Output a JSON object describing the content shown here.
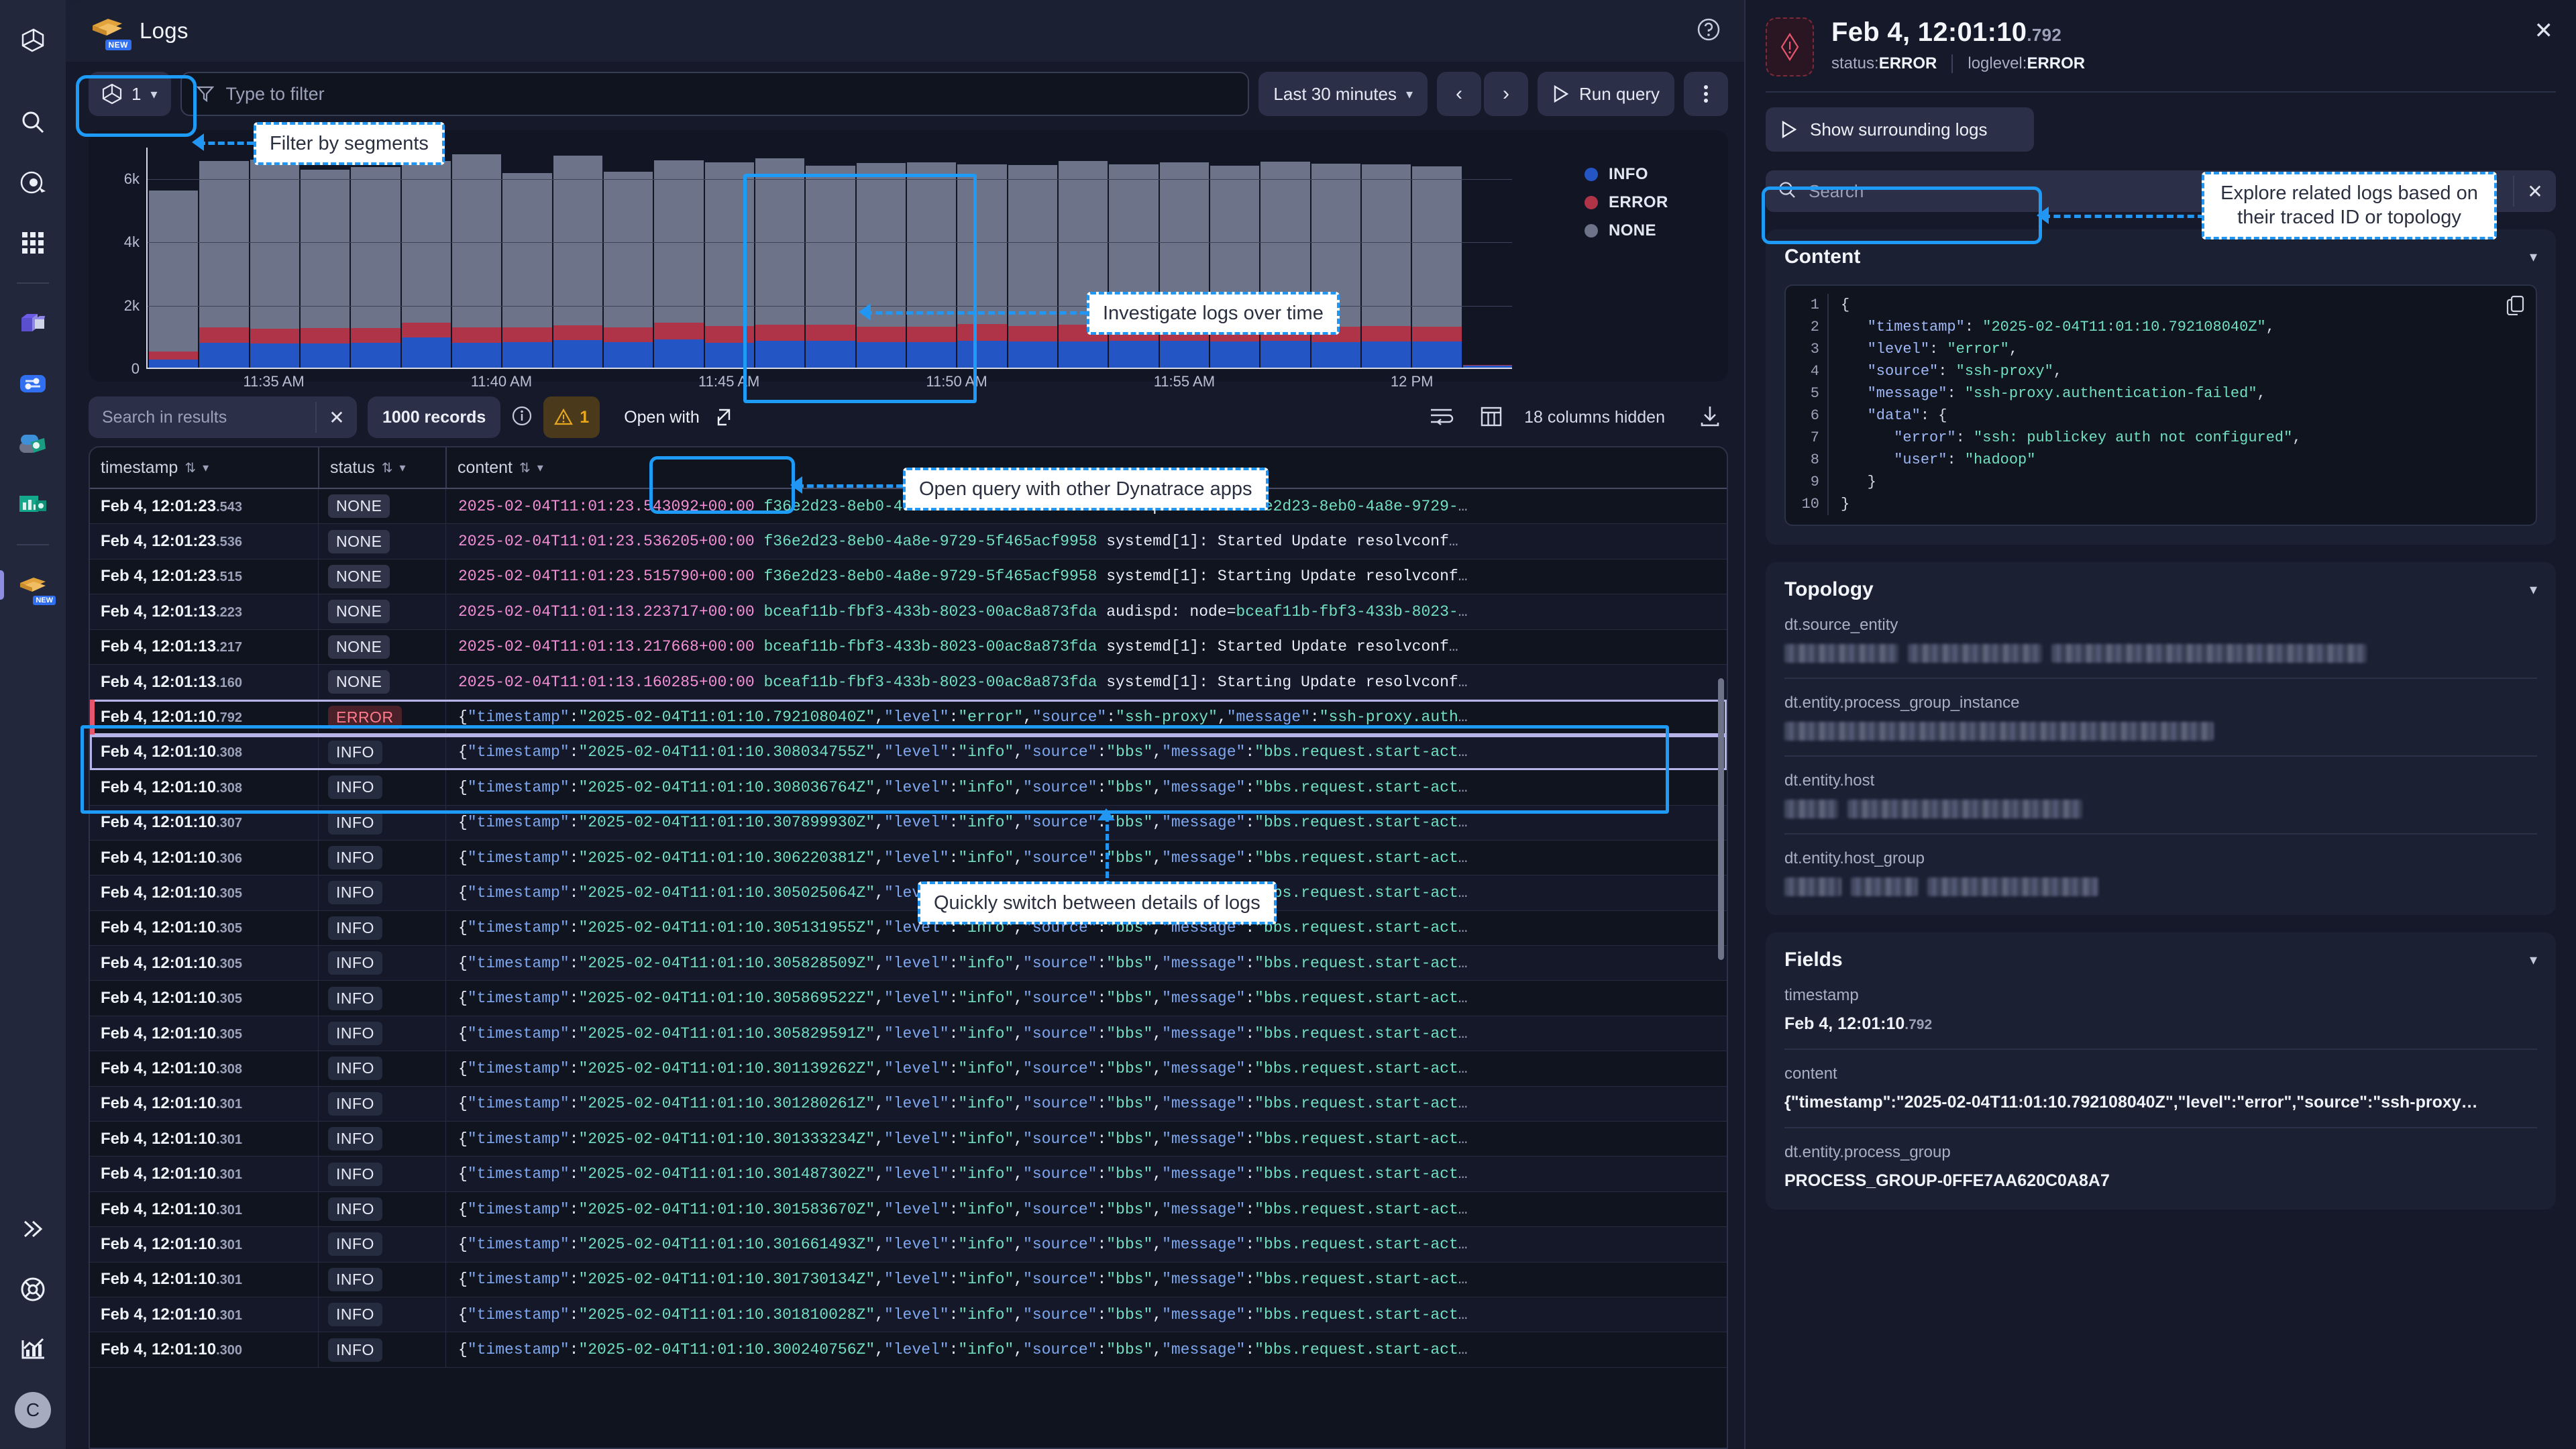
{
  "rail": {
    "items": [
      {
        "name": "dynatrace-logo-icon",
        "label": "Dynatrace"
      },
      {
        "name": "search-icon",
        "label": "Search"
      },
      {
        "name": "davis-ai-icon",
        "label": "Davis AI"
      },
      {
        "name": "apps-grid-icon",
        "label": "Apps"
      },
      {
        "name": "kubernetes-app-icon",
        "label": "Kubernetes"
      },
      {
        "name": "distributed-tracing-app-icon",
        "label": "Distributed Tracing"
      },
      {
        "name": "databases-app-icon",
        "label": "Databases"
      },
      {
        "name": "dashboards-app-icon",
        "label": "Dashboards"
      },
      {
        "name": "logs-app-icon",
        "label": "Logs",
        "badge": "NEW",
        "active": true
      },
      {
        "name": "expand-rail-icon",
        "label": "Expand"
      },
      {
        "name": "support-icon",
        "label": "Support"
      },
      {
        "name": "analytics-icon",
        "label": "Analytics"
      }
    ],
    "avatar_initial": "C"
  },
  "titlebar": {
    "app_name": "Logs",
    "badge": "NEW",
    "help_icon": "help-circle-icon"
  },
  "toolbar": {
    "segment_count": "1",
    "filter_placeholder": "Type to filter",
    "timeframe": "Last 30 minutes",
    "prev_label": "‹",
    "next_label": "›",
    "run_query_label": "Run query",
    "more_label": "⋮"
  },
  "chart_data": {
    "type": "bar",
    "title": "",
    "xlabel": "",
    "ylabel": "",
    "stacked": true,
    "grid": true,
    "legend_position": "right",
    "ylim": [
      0,
      7000
    ],
    "yticks": [
      0,
      2000,
      4000,
      6000
    ],
    "ytick_labels": [
      "0",
      "2k",
      "4k",
      "6k"
    ],
    "xtick_labels": [
      "11:35 AM",
      "11:40 AM",
      "11:45 AM",
      "11:50 AM",
      "11:55 AM",
      "12 PM"
    ],
    "legend": [
      {
        "name": "INFO",
        "color": "#2455c4"
      },
      {
        "name": "ERROR",
        "color": "#b03448"
      },
      {
        "name": "NONE",
        "color": "#6d7389"
      }
    ],
    "series": [
      {
        "name": "INFO",
        "color": "#2455c4",
        "values": [
          260,
          780,
          760,
          760,
          790,
          960,
          790,
          810,
          870,
          800,
          900,
          790,
          840,
          840,
          800,
          810,
          850,
          830,
          830,
          850,
          840,
          820,
          840,
          800,
          830,
          820,
          60
        ]
      },
      {
        "name": "ERROR",
        "color": "#b03448",
        "values": [
          250,
          500,
          480,
          500,
          470,
          470,
          490,
          460,
          470,
          470,
          520,
          520,
          520,
          510,
          500,
          490,
          520,
          490,
          520,
          490,
          510,
          480,
          490,
          500,
          480,
          470,
          30
        ]
      },
      {
        "name": "NONE",
        "color": "#6d7389",
        "values": [
          5080,
          5260,
          5330,
          5000,
          5080,
          5110,
          5460,
          4880,
          5370,
          4920,
          5140,
          5190,
          5250,
          5040,
          5160,
          5200,
          5060,
          5080,
          5190,
          5080,
          5140,
          5080,
          5180,
          5140,
          5120,
          5080,
          0
        ]
      }
    ]
  },
  "results": {
    "search_placeholder": "Search in results",
    "record_count": "1000 records",
    "info_icon": "info-circle-icon",
    "warning_count": "1",
    "open_with_label": "Open with",
    "wrap_lines_icon": "wrap-lines-icon",
    "columns_icon": "table-columns-icon",
    "columns_hidden": "18 columns hidden",
    "download_icon": "download-icon"
  },
  "table": {
    "columns": [
      {
        "key": "timestamp",
        "label": "timestamp"
      },
      {
        "key": "status",
        "label": "status"
      },
      {
        "key": "content",
        "label": "content"
      }
    ],
    "rows": [
      {
        "ts": "Feb 4, 12:01:23",
        "ms": ".543",
        "status": "NONE",
        "kind": "syslog",
        "iso": "2025-02-04T11:01:23.543092+00:00",
        "uuid": "f36e2d23-8eb0-4a8e-9729-5f465acf9958",
        "msg": "audispd: node=f36e2d23-8eb0-4a8e-9729-",
        "msg_teal_tail": true
      },
      {
        "ts": "Feb 4, 12:01:23",
        "ms": ".536",
        "status": "NONE",
        "kind": "syslog",
        "iso": "2025-02-04T11:01:23.536205+00:00",
        "uuid": "f36e2d23-8eb0-4a8e-9729-5f465acf9958",
        "msg": "systemd[1]: Started Update resolvconf "
      },
      {
        "ts": "Feb 4, 12:01:23",
        "ms": ".515",
        "status": "NONE",
        "kind": "syslog",
        "iso": "2025-02-04T11:01:23.515790+00:00",
        "uuid": "f36e2d23-8eb0-4a8e-9729-5f465acf9958",
        "msg": "systemd[1]: Starting Update resolvconf"
      },
      {
        "ts": "Feb 4, 12:01:13",
        "ms": ".223",
        "status": "NONE",
        "kind": "syslog",
        "iso": "2025-02-04T11:01:13.223717+00:00",
        "uuid": "bceaf11b-fbf3-433b-8023-00ac8a873fda",
        "msg": "audispd: node=bceaf11b-fbf3-433b-8023-",
        "msg_teal_tail": true
      },
      {
        "ts": "Feb 4, 12:01:13",
        "ms": ".217",
        "status": "NONE",
        "kind": "syslog",
        "iso": "2025-02-04T11:01:13.217668+00:00",
        "uuid": "bceaf11b-fbf3-433b-8023-00ac8a873fda",
        "msg": "systemd[1]: Started Update resolvconf "
      },
      {
        "ts": "Feb 4, 12:01:13",
        "ms": ".160",
        "status": "NONE",
        "kind": "syslog",
        "selected_top": true,
        "iso": "2025-02-04T11:01:13.160285+00:00",
        "uuid": "bceaf11b-fbf3-433b-8023-00ac8a873fda",
        "msg": "systemd[1]: Starting Update resolvconf"
      },
      {
        "ts": "Feb 4, 12:01:10",
        "ms": ".792",
        "status": "ERROR",
        "kind": "json",
        "active": true,
        "json_ts": "2025-02-04T11:01:10.792108040Z",
        "level": "error",
        "source": "ssh-proxy",
        "msg_key": "message",
        "msg_val": "ssh-proxy.auth"
      },
      {
        "ts": "Feb 4, 12:01:10",
        "ms": ".308",
        "status": "INFO",
        "kind": "json",
        "selected_bottom": true,
        "json_ts": "2025-02-04T11:01:10.308034755Z",
        "level": "info",
        "source": "bbs",
        "msg_key": "message",
        "msg_val": "bbs.request.start-act"
      },
      {
        "ts": "Feb 4, 12:01:10",
        "ms": ".308",
        "status": "INFO",
        "kind": "json",
        "json_ts": "2025-02-04T11:01:10.308036764Z",
        "level": "info",
        "source": "bbs",
        "msg_key": "message",
        "msg_val": "bbs.request.start-act"
      },
      {
        "ts": "Feb 4, 12:01:10",
        "ms": ".307",
        "status": "INFO",
        "kind": "json",
        "json_ts": "2025-02-04T11:01:10.307899930Z",
        "level": "info",
        "source": "bbs",
        "msg_key": "message",
        "msg_val": "bbs.request.start-act"
      },
      {
        "ts": "Feb 4, 12:01:10",
        "ms": ".306",
        "status": "INFO",
        "kind": "json",
        "json_ts": "2025-02-04T11:01:10.306220381Z",
        "level": "info",
        "source": "bbs",
        "msg_key": "message",
        "msg_val": "bbs.request.start-act"
      },
      {
        "ts": "Feb 4, 12:01:10",
        "ms": ".305",
        "status": "INFO",
        "kind": "json",
        "json_ts": "2025-02-04T11:01:10.305025064Z",
        "level": "info",
        "source": "bbs",
        "msg_key": "message",
        "msg_val": "bbs.request.start-act"
      },
      {
        "ts": "Feb 4, 12:01:10",
        "ms": ".305",
        "status": "INFO",
        "kind": "json",
        "json_ts": "2025-02-04T11:01:10.305131955Z",
        "level": "info",
        "source": "bbs",
        "msg_key": "message",
        "msg_val": "bbs.request.start-act"
      },
      {
        "ts": "Feb 4, 12:01:10",
        "ms": ".305",
        "status": "INFO",
        "kind": "json",
        "json_ts": "2025-02-04T11:01:10.305828509Z",
        "level": "info",
        "source": "bbs",
        "msg_key": "message",
        "msg_val": "bbs.request.start-act"
      },
      {
        "ts": "Feb 4, 12:01:10",
        "ms": ".305",
        "status": "INFO",
        "kind": "json",
        "json_ts": "2025-02-04T11:01:10.305869522Z",
        "level": "info",
        "source": "bbs",
        "msg_key": "message",
        "msg_val": "bbs.request.start-act"
      },
      {
        "ts": "Feb 4, 12:01:10",
        "ms": ".305",
        "status": "INFO",
        "kind": "json",
        "json_ts": "2025-02-04T11:01:10.305829591Z",
        "level": "info",
        "source": "bbs",
        "msg_key": "message",
        "msg_val": "bbs.request.start-act"
      },
      {
        "ts": "Feb 4, 12:01:10",
        "ms": ".308",
        "status": "INFO",
        "kind": "json",
        "json_ts": "2025-02-04T11:01:10.301139262Z",
        "level": "info",
        "source": "bbs",
        "msg_key": "message",
        "msg_val": "bbs.request.start-act"
      },
      {
        "ts": "Feb 4, 12:01:10",
        "ms": ".301",
        "status": "INFO",
        "kind": "json",
        "json_ts": "2025-02-04T11:01:10.301280261Z",
        "level": "info",
        "source": "bbs",
        "msg_key": "message",
        "msg_val": "bbs.request.start-act"
      },
      {
        "ts": "Feb 4, 12:01:10",
        "ms": ".301",
        "status": "INFO",
        "kind": "json",
        "json_ts": "2025-02-04T11:01:10.301333234Z",
        "level": "info",
        "source": "bbs",
        "msg_key": "message",
        "msg_val": "bbs.request.start-act"
      },
      {
        "ts": "Feb 4, 12:01:10",
        "ms": ".301",
        "status": "INFO",
        "kind": "json",
        "json_ts": "2025-02-04T11:01:10.301487302Z",
        "level": "info",
        "source": "bbs",
        "msg_key": "message",
        "msg_val": "bbs.request.start-act"
      },
      {
        "ts": "Feb 4, 12:01:10",
        "ms": ".301",
        "status": "INFO",
        "kind": "json",
        "json_ts": "2025-02-04T11:01:10.301583670Z",
        "level": "info",
        "source": "bbs",
        "msg_key": "message",
        "msg_val": "bbs.request.start-act"
      },
      {
        "ts": "Feb 4, 12:01:10",
        "ms": ".301",
        "status": "INFO",
        "kind": "json",
        "json_ts": "2025-02-04T11:01:10.301661493Z",
        "level": "info",
        "source": "bbs",
        "msg_key": "message",
        "msg_val": "bbs.request.start-act"
      },
      {
        "ts": "Feb 4, 12:01:10",
        "ms": ".301",
        "status": "INFO",
        "kind": "json",
        "json_ts": "2025-02-04T11:01:10.301730134Z",
        "level": "info",
        "source": "bbs",
        "msg_key": "message",
        "msg_val": "bbs.request.start-act"
      },
      {
        "ts": "Feb 4, 12:01:10",
        "ms": ".301",
        "status": "INFO",
        "kind": "json",
        "json_ts": "2025-02-04T11:01:10.301810028Z",
        "level": "info",
        "source": "bbs",
        "msg_key": "message",
        "msg_val": "bbs.request.start-act"
      },
      {
        "ts": "Feb 4, 12:01:10",
        "ms": ".300",
        "status": "INFO",
        "kind": "json",
        "json_ts": "2025-02-04T11:01:10.300240756Z",
        "level": "info",
        "source": "bbs",
        "msg_key": "message",
        "msg_val": "bbs.request.start-act"
      }
    ]
  },
  "detail": {
    "title": "Feb 4, 12:01:10",
    "title_ms": ".792",
    "status_key": "status",
    "status_value": "ERROR",
    "loglevel_key": "loglevel",
    "loglevel_value": "ERROR",
    "close_label": "✕",
    "surrounding_logs_label": "Show surrounding logs",
    "search_placeholder": "Search",
    "content_section": {
      "title": "Content",
      "copy_icon": "copy-icon",
      "lines": [
        {
          "n": "1",
          "parts": [
            {
              "t": "{",
              "c": "cp"
            }
          ]
        },
        {
          "n": "2",
          "indent": 1,
          "parts": [
            {
              "t": "\"timestamp\"",
              "c": "ck"
            },
            {
              "t": ": ",
              "c": "cp"
            },
            {
              "t": "\"2025-02-04T11:01:10.792108040Z\"",
              "c": "cv"
            },
            {
              "t": ",",
              "c": "cp"
            }
          ]
        },
        {
          "n": "3",
          "indent": 1,
          "parts": [
            {
              "t": "\"level\"",
              "c": "ck"
            },
            {
              "t": ": ",
              "c": "cp"
            },
            {
              "t": "\"error\"",
              "c": "cv"
            },
            {
              "t": ",",
              "c": "cp"
            }
          ]
        },
        {
          "n": "4",
          "indent": 1,
          "parts": [
            {
              "t": "\"source\"",
              "c": "ck"
            },
            {
              "t": ": ",
              "c": "cp"
            },
            {
              "t": "\"ssh-proxy\"",
              "c": "cv"
            },
            {
              "t": ",",
              "c": "cp"
            }
          ]
        },
        {
          "n": "5",
          "indent": 1,
          "parts": [
            {
              "t": "\"message\"",
              "c": "ck"
            },
            {
              "t": ": ",
              "c": "cp"
            },
            {
              "t": "\"ssh-proxy.authentication-failed\"",
              "c": "cv"
            },
            {
              "t": ",",
              "c": "cp"
            }
          ]
        },
        {
          "n": "6",
          "indent": 1,
          "parts": [
            {
              "t": "\"data\"",
              "c": "ck"
            },
            {
              "t": ": {",
              "c": "cp"
            }
          ]
        },
        {
          "n": "7",
          "indent": 2,
          "parts": [
            {
              "t": "\"error\"",
              "c": "ck"
            },
            {
              "t": ": ",
              "c": "cp"
            },
            {
              "t": "\"ssh: publickey auth not configured\"",
              "c": "cv"
            },
            {
              "t": ",",
              "c": "cp"
            }
          ]
        },
        {
          "n": "8",
          "indent": 2,
          "parts": [
            {
              "t": "\"user\"",
              "c": "ck"
            },
            {
              "t": ": ",
              "c": "cp"
            },
            {
              "t": "\"hadoop\"",
              "c": "cv"
            }
          ]
        },
        {
          "n": "9",
          "indent": 1,
          "parts": [
            {
              "t": "}",
              "c": "cp"
            }
          ]
        },
        {
          "n": "10",
          "parts": [
            {
              "t": "}",
              "c": "cp"
            }
          ]
        }
      ]
    },
    "topology_section": {
      "title": "Topology",
      "rows": [
        {
          "key": "dt.source_entity",
          "redacted": true,
          "widths": [
            170,
            200,
            470
          ]
        },
        {
          "key": "dt.entity.process_group_instance",
          "redacted": true,
          "widths": [
            640
          ]
        },
        {
          "key": "dt.entity.host",
          "redacted": true,
          "widths": [
            80,
            350
          ]
        },
        {
          "key": "dt.entity.host_group",
          "redacted": true,
          "widths": [
            85,
            100,
            255
          ]
        }
      ]
    },
    "fields_section": {
      "title": "Fields",
      "rows": [
        {
          "key": "timestamp",
          "value": "Feb 4, 12:01:10",
          "value_ms": ".792"
        },
        {
          "key": "content",
          "value": "{\"timestamp\":\"2025-02-04T11:01:10.792108040Z\",\"level\":\"error\",\"source\":\"ssh-proxy…"
        },
        {
          "key": "dt.entity.process_group",
          "value": "PROCESS_GROUP-0FFE7AA620C0A8A7"
        }
      ]
    }
  },
  "callouts": [
    {
      "id": "filter-by-segments",
      "text": "Filter by segments"
    },
    {
      "id": "investigate-logs-over-time",
      "text": "Investigate logs over time"
    },
    {
      "id": "open-query-with-other-apps",
      "text": "Open query with other Dynatrace apps"
    },
    {
      "id": "quickly-switch-between-details",
      "text": "Quickly switch between details of logs"
    },
    {
      "id": "explore-related-logs",
      "text": "Explore related logs based on their traced ID or topology"
    }
  ],
  "colors": {
    "accent": "#1d9bf6",
    "info": "#2455c4",
    "error": "#b03448",
    "none": "#6d7389",
    "warning": "#e8a81e"
  }
}
